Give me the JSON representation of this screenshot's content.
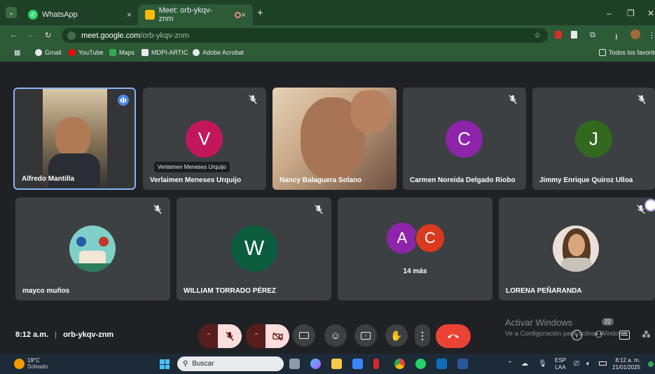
{
  "browser": {
    "tabs": [
      {
        "title": "WhatsApp",
        "close": "×"
      },
      {
        "title": "Meet: orb-ykqv-znm",
        "close": "×"
      }
    ],
    "new_tab": "+",
    "window_controls": {
      "minimize": "–",
      "restore": "❐",
      "close": "✕"
    },
    "url_host": "meet.google.com",
    "url_path": "/orb-ykqv-znm",
    "bookmarks": [
      "Gmail",
      "YouTube",
      "Maps",
      "MDPI-ARTIC",
      "Adobe Acrobat"
    ],
    "all_bookmarks": "Todos los favoritos"
  },
  "participants": [
    {
      "name": "Alfredo Mantilla"
    },
    {
      "name": "Verlaimen Meneses Urquijo",
      "initial": "V",
      "tooltip": "Verlaimen Meneses Urquijo",
      "color": "#c2185b"
    },
    {
      "name": "Nancy Balaguera Solano"
    },
    {
      "name": "Carmen Noreida Delgado Riobo",
      "initial": "C",
      "color": "#8e24aa"
    },
    {
      "name": "Jimmy Enrique Quiroz Ulloa",
      "initial": "J",
      "color": "#33691e"
    },
    {
      "name": "mayco muños"
    },
    {
      "name": "WILLIAM TORRADO PÉREZ",
      "initial": "W",
      "color": "#0b5d3d"
    },
    {
      "name": "14 más",
      "initials": [
        "A",
        "C"
      ],
      "colors": [
        "#8e24aa",
        "#d93a1d"
      ]
    },
    {
      "name": "LORENA PEÑARANDA"
    }
  ],
  "meeting": {
    "time": "8:12 a.m.",
    "separator": "|",
    "code": "orb-ykqv-znm",
    "participants_count": "22"
  },
  "watermark": {
    "title": "Activar Windows",
    "subtitle": "Ve a Configuración para activar Windows."
  },
  "taskbar": {
    "weather_temp": "19°C",
    "weather_desc": "Soleado",
    "search_placeholder": "Buscar",
    "lang": "ESP",
    "lang_sub": "LAA",
    "clock_time": "8:12 a. m.",
    "clock_date": "21/01/2025"
  },
  "colors": {
    "accent_green": "#2d5a37",
    "end_call": "#ea4335",
    "muted_bg": "#f9dedc",
    "active_speaker": "#8ab4f8"
  }
}
